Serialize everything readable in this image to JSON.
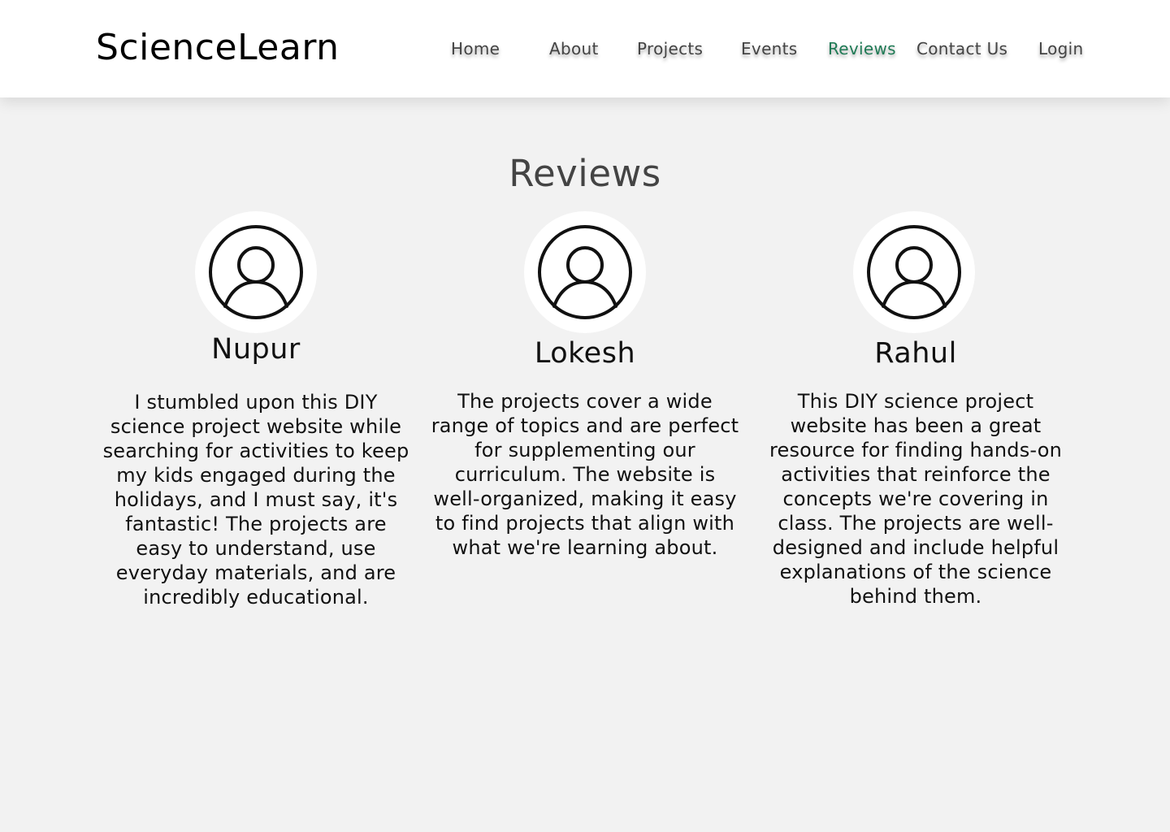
{
  "header": {
    "logo": "ScienceLearn",
    "nav": [
      {
        "label": "Home"
      },
      {
        "label": "About"
      },
      {
        "label": "Projects"
      },
      {
        "label": "Events"
      },
      {
        "label": "Reviews",
        "active": true
      },
      {
        "label": "Contact Us"
      },
      {
        "label": "Login"
      }
    ]
  },
  "colors": {
    "active_nav": "#1f7a55",
    "page_background": "#f2f2f2",
    "header_background": "#ffffff"
  },
  "main": {
    "title": "Reviews",
    "reviews": [
      {
        "avatar_icon": "user-avatar-icon",
        "name": "Nupur",
        "text": "I stumbled upon this DIY science project website while searching for activities to keep my kids engaged during the holidays, and I must say, it's fantastic! The projects are easy to understand, use everyday materials, and are incredibly educational."
      },
      {
        "avatar_icon": "user-avatar-icon",
        "name": "Lokesh",
        "text": "The projects cover a wide range of topics and are perfect for supplementing our curriculum. The website is well-organized, making it easy to find projects that align with what we're learning about."
      },
      {
        "avatar_icon": "user-avatar-icon",
        "name": "Rahul",
        "text": "This DIY science project website has been a great resource for finding hands-on activities that reinforce the concepts we're covering in class. The projects are well-designed and include helpful explanations of the science behind them."
      }
    ]
  }
}
